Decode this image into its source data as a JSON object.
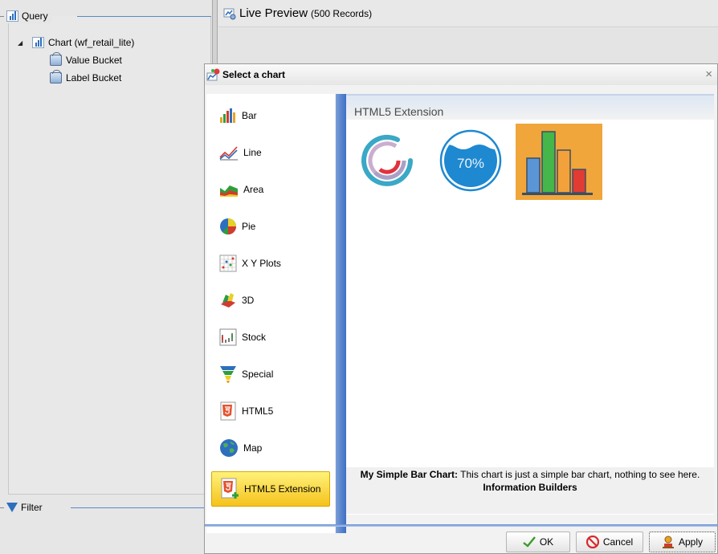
{
  "query_panel": {
    "legend": "Query",
    "tree": {
      "root": "Chart (wf_retail_lite)",
      "children": [
        "Value Bucket",
        "Label Bucket"
      ]
    },
    "filter_legend": "Filter"
  },
  "preview": {
    "title": "Live Preview",
    "record_count": "(500 Records)"
  },
  "dialog": {
    "title": "Select a chart",
    "close_glyph": "×",
    "categories": [
      {
        "label": "Bar",
        "icon": "bar-chart-icon"
      },
      {
        "label": "Line",
        "icon": "line-chart-icon"
      },
      {
        "label": "Area",
        "icon": "area-chart-icon"
      },
      {
        "label": "Pie",
        "icon": "pie-chart-icon"
      },
      {
        "label": "X Y Plots",
        "icon": "xy-plot-icon"
      },
      {
        "label": "3D",
        "icon": "3d-chart-icon"
      },
      {
        "label": "Stock",
        "icon": "stock-chart-icon"
      },
      {
        "label": "Special",
        "icon": "funnel-chart-icon"
      },
      {
        "label": "HTML5",
        "icon": "html5-icon"
      },
      {
        "label": "Map",
        "icon": "globe-icon"
      },
      {
        "label": "HTML5 Extension",
        "icon": "html5-extension-icon",
        "selected": true
      }
    ],
    "content": {
      "title": "HTML5 Extension",
      "gauge_value": "70%",
      "thumbnails": [
        "ring-chart-thumbnail",
        "liquid-gauge-thumbnail",
        "simple-bar-chart-thumbnail"
      ]
    },
    "description": {
      "name": "My Simple Bar Chart:",
      "text": "This chart is just a simple bar chart, nothing to see here.",
      "author": "Information Builders"
    },
    "buttons": {
      "ok": "OK",
      "cancel": "Cancel",
      "apply": "Apply"
    }
  },
  "colors": {
    "selection_yellow": "#f5c21c",
    "accent_blue": "#3e6fc5",
    "bar_thumb_bg": "#f0a63a"
  }
}
